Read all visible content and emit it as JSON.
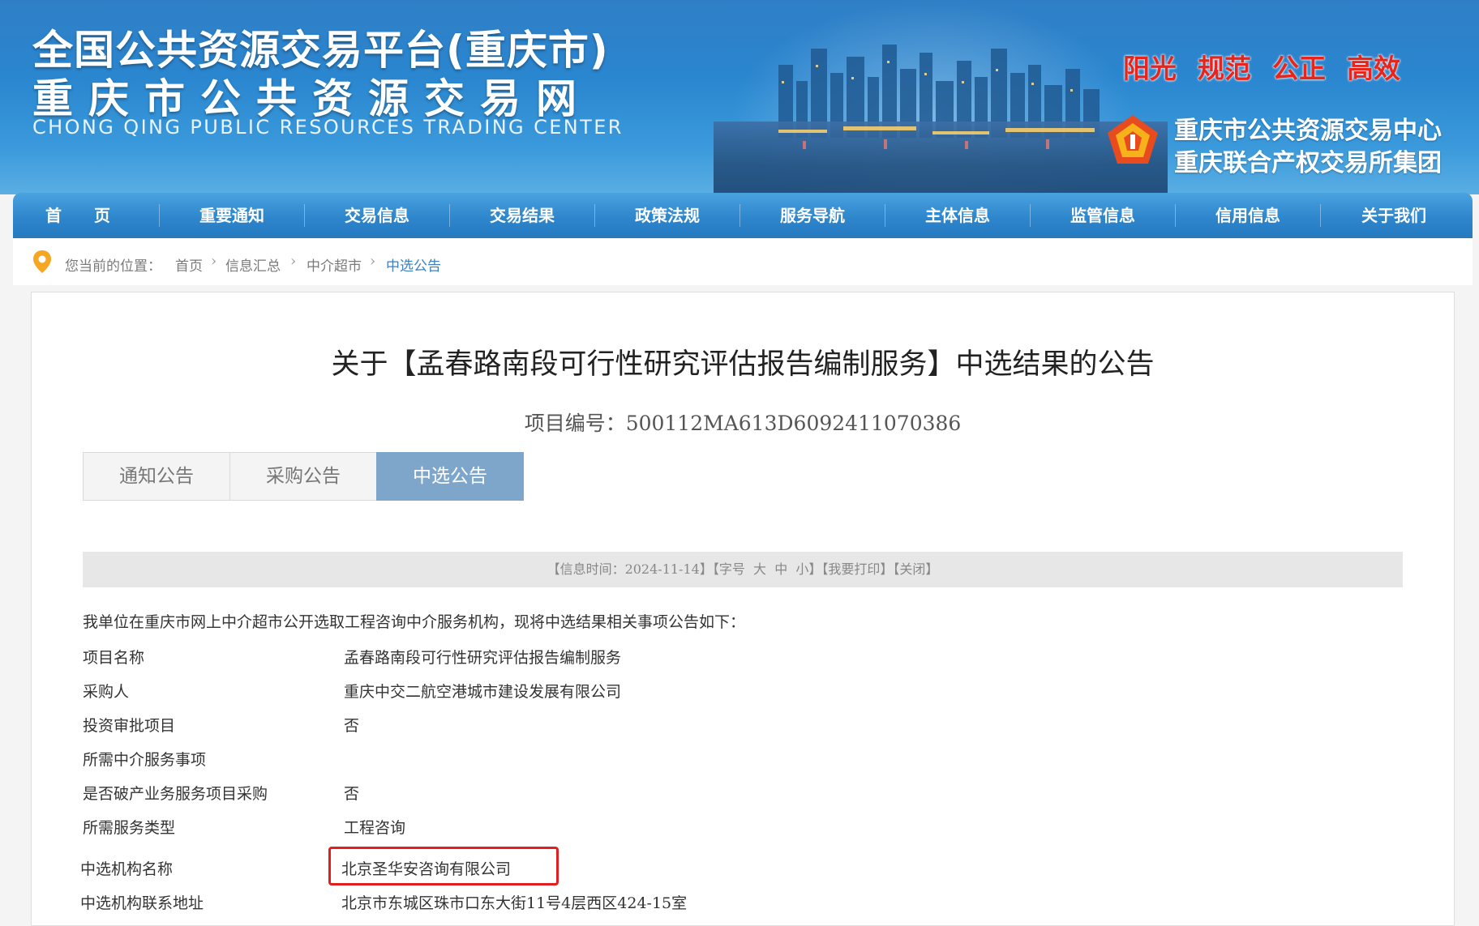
{
  "banner": {
    "title_line1": "全国公共资源交易平台(重庆市)",
    "title_line2": "重庆市公共资源交易网",
    "title_en": "CHONG QING PUBLIC RESOURCES TRADING CENTER",
    "slogans": [
      "阳光",
      "规范",
      "公正",
      "高效"
    ],
    "org_line1": "重庆市公共资源交易中心",
    "org_line2": "重庆联合产权交易所集团",
    "colors": {
      "banner_blue": "#2a86cf",
      "slogan_red": "#e8251c"
    }
  },
  "nav": {
    "items": [
      "首　　页",
      "重要通知",
      "交易信息",
      "交易结果",
      "政策法规",
      "服务导航",
      "主体信息",
      "监管信息",
      "信用信息",
      "关于我们"
    ]
  },
  "breadcrumb": {
    "prefix": "您当前的位置：",
    "items": [
      "首页",
      "信息汇总",
      "中介超市",
      "中选公告"
    ]
  },
  "article": {
    "title": "关于【孟春路南段可行性研究评估报告编制服务】中选结果的公告",
    "project_no": "项目编号：500112MA613D6092411070386",
    "tabs": [
      "通知公告",
      "采购公告",
      "中选公告"
    ],
    "active_tab": "中选公告",
    "info_bar": {
      "time": "【信息时间：2024-11-14】",
      "font_label": "【字号",
      "font_large": "大",
      "font_medium": "中",
      "font_small": "小】",
      "print": "【我要打印】",
      "close": "【关闭】"
    },
    "intro": "我单位在重庆市网上中介超市公开选取工程咨询中介服务机构，现将中选结果相关事项公告如下：",
    "rows": [
      {
        "key": "项目名称",
        "value": "孟春路南段可行性研究评估报告编制服务"
      },
      {
        "key": "采购人",
        "value": "重庆中交二航空港城市建设发展有限公司"
      },
      {
        "key": "投资审批项目",
        "value": "否"
      },
      {
        "key": "所需中介服务事项",
        "value": ""
      },
      {
        "key": "是否破产业务服务项目采购",
        "value": "否"
      },
      {
        "key": "所需服务类型",
        "value": "工程咨询"
      },
      {
        "key": "中选机构名称",
        "value": "北京圣华安咨询有限公司"
      },
      {
        "key": "中选机构联系地址",
        "value": "北京市东城区珠市口东大街11号4层西区424-15室"
      }
    ],
    "colors": {
      "active_tab": "#7ea6cb",
      "highlight_border": "#e02020"
    }
  }
}
